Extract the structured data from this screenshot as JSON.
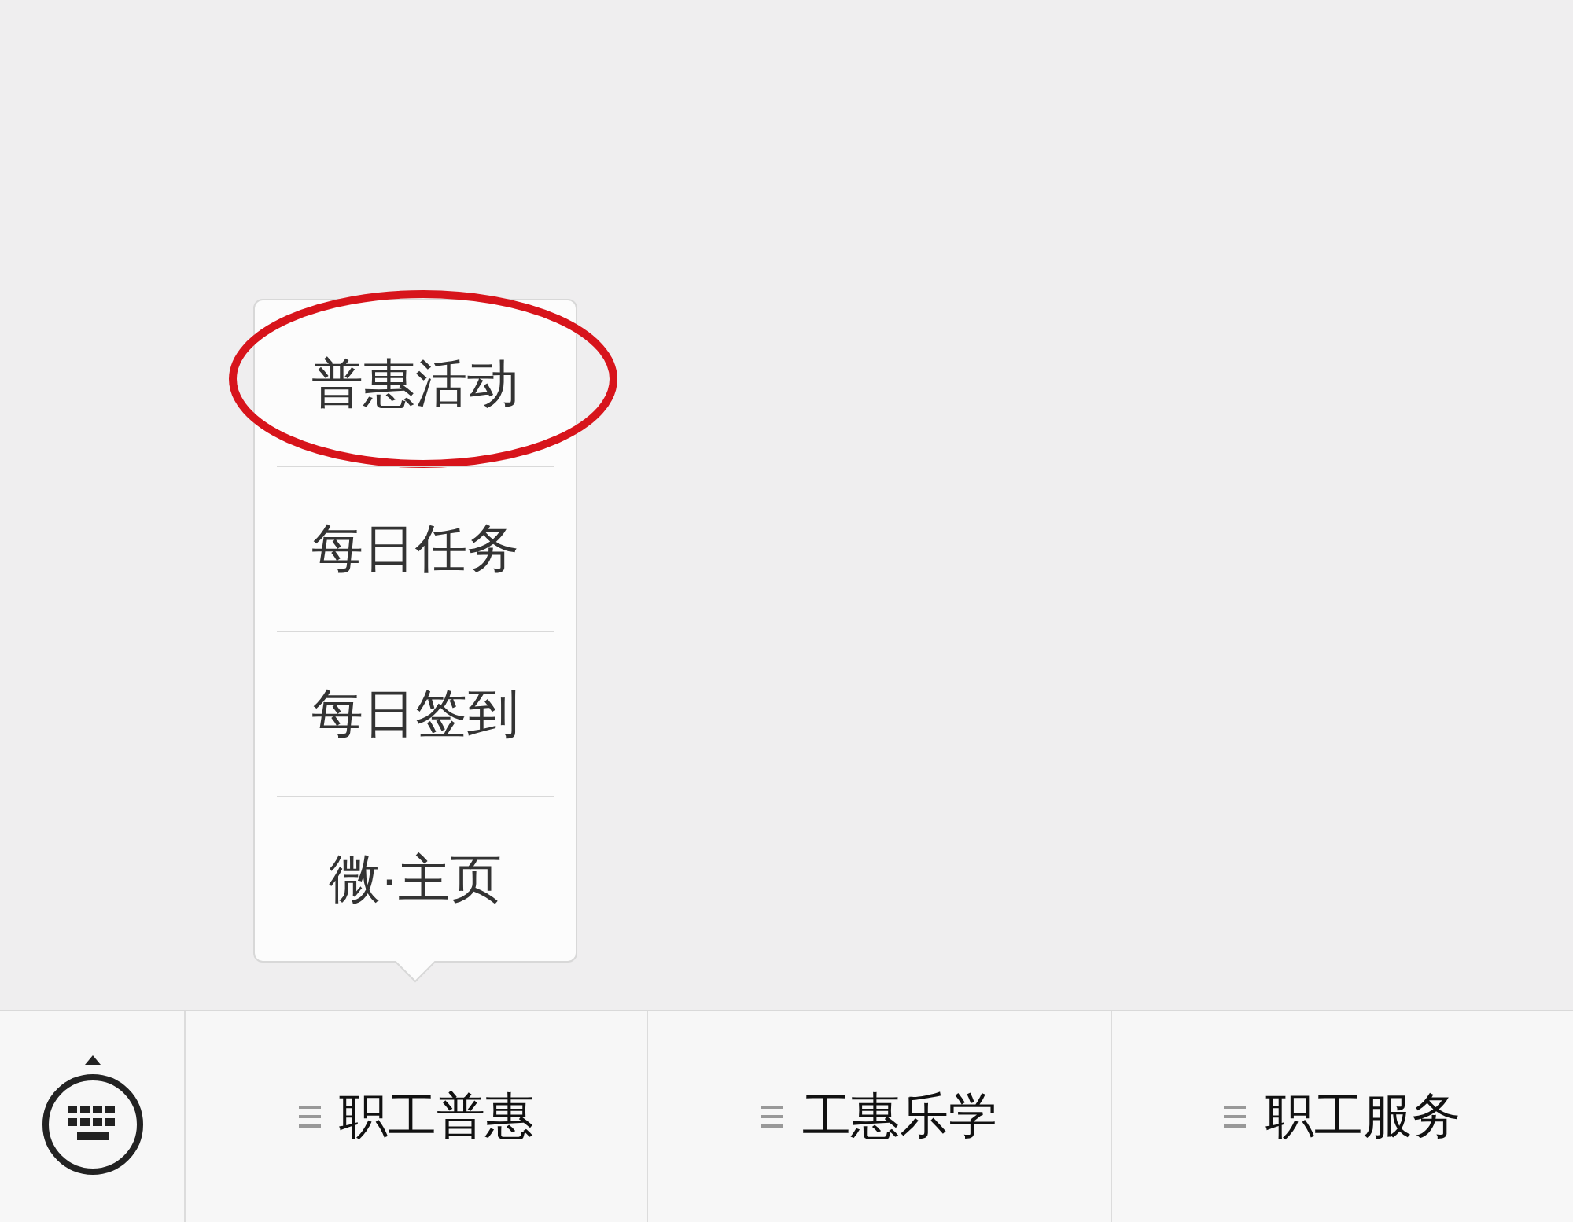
{
  "menu_items": [
    {
      "label": "普惠活动",
      "circled": true
    },
    {
      "label": "每日任务",
      "circled": false
    },
    {
      "label": "每日签到",
      "circled": false
    },
    {
      "label": "微·主页",
      "circled": false
    }
  ],
  "tabs": [
    {
      "label": "职工普惠",
      "expanded": true
    },
    {
      "label": "工惠乐学",
      "expanded": false
    },
    {
      "label": "职工服务",
      "expanded": false
    }
  ]
}
